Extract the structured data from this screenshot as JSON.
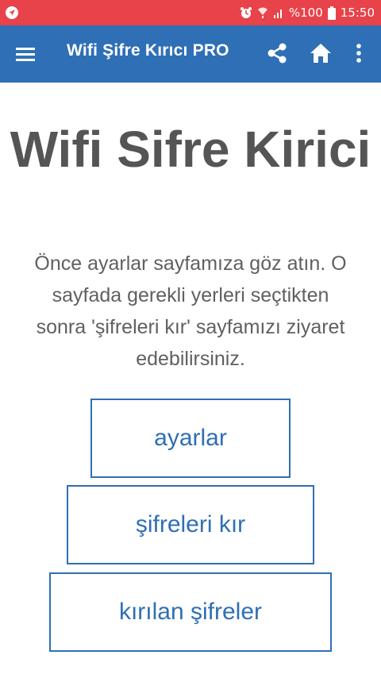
{
  "status_bar": {
    "battery_percent": "%100",
    "time": "15:50",
    "icons": [
      "navigation-icon",
      "alarm-icon",
      "wifi-icon",
      "signal-icon",
      "battery-icon"
    ]
  },
  "app_bar": {
    "title": "Wifi Şifre Kırıcı PRO",
    "icons": [
      "menu-icon",
      "share-icon",
      "home-icon",
      "more-vert-icon"
    ]
  },
  "main": {
    "title": "Wifi Sifre Kirici",
    "description": "Önce ayarlar sayfamıza göz atın. O sayfada gerekli yerleri seçtikten sonra 'şifreleri kır' sayfamızı ziyaret edebilirsiniz.",
    "buttons": {
      "settings": "ayarlar",
      "crack": "şifreleri kır",
      "cracked": "kırılan şifreler"
    }
  },
  "colors": {
    "status_bar": "#e8424a",
    "app_bar": "#2f6fb5",
    "button_border": "#2f6fb5",
    "title_text": "#555555"
  }
}
